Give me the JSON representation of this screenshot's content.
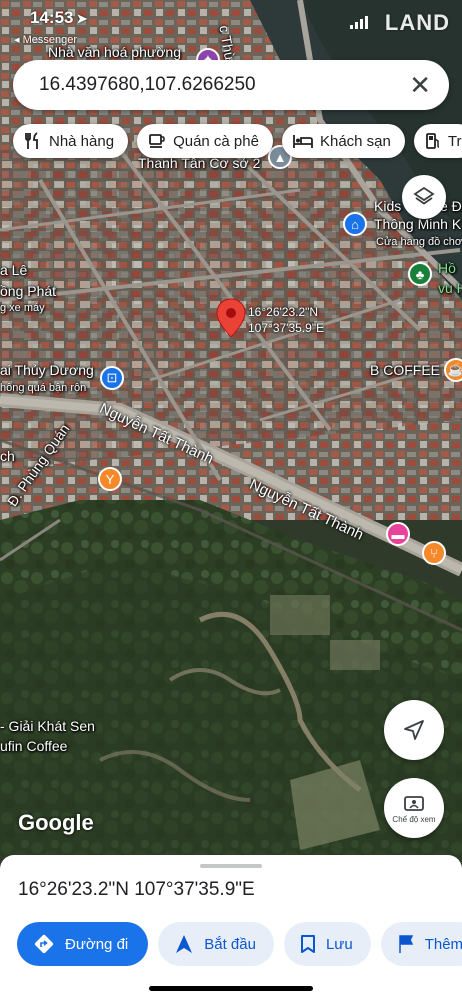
{
  "status_bar": {
    "time": "14:53",
    "back_app": "◂ Messenger",
    "watermark": "LAND"
  },
  "search": {
    "value": "16.4397680,107.6266250"
  },
  "chips": [
    {
      "label": "Nhà hàng",
      "icon": "restaurant-icon"
    },
    {
      "label": "Quán cà phê",
      "icon": "coffee-icon"
    },
    {
      "label": "Khách sạn",
      "icon": "hotel-icon"
    },
    {
      "label": "Tr",
      "icon": "gas-station-icon"
    }
  ],
  "map": {
    "labels": {
      "nha_van_hoa": "Nhà văn hoá phường",
      "thua_du": "c Thừa D",
      "thanh_tan": "Thanh Tân Cơ sở 2",
      "kids": "Kids",
      "kids_2": "e Đ",
      "thong_minh": "Thông Minh K",
      "cua_hang": "Cửa hàng đồ chơ",
      "ho": "Hồ",
      "vu_h": "vu H",
      "ra_le": "a Lê",
      "dong_phat": "ồng Phát",
      "xe_may": "g xe máy",
      "thuy_duong": "ai Thủy Dương",
      "thuy_duong_sub": "hông quá bận rộn",
      "b_coffee": "B COFFEE",
      "phung_quan": "Đ. Phùng Quán",
      "ch": "ch",
      "road_1": "Nguyễn Tất Thành",
      "road_2": "Nguyễn Tất Thành",
      "giai_khat": "- Giải Khát Sen",
      "ufin": "ufin Coffee"
    },
    "pin": {
      "lat": "16°26'23.2\"N",
      "lng": "107°37'35.9\"E",
      "color": "#ea4335"
    },
    "google_logo": "Google",
    "street_view_label": "Chế độ xem",
    "poi_colors": {
      "shopping": "#1a73e8",
      "food": "#f5892a",
      "hotel": "#e8439a",
      "park": "#188038"
    }
  },
  "sheet": {
    "title": "16°26'23.2\"N 107°37'35.9\"E",
    "actions": [
      {
        "label": "Đường đi",
        "icon": "directions-icon"
      },
      {
        "label": "Bắt đầu",
        "icon": "navigation-arrow-icon"
      },
      {
        "label": "Lưu",
        "icon": "bookmark-icon"
      },
      {
        "label": "Thêm",
        "icon": "flag-icon"
      }
    ]
  }
}
